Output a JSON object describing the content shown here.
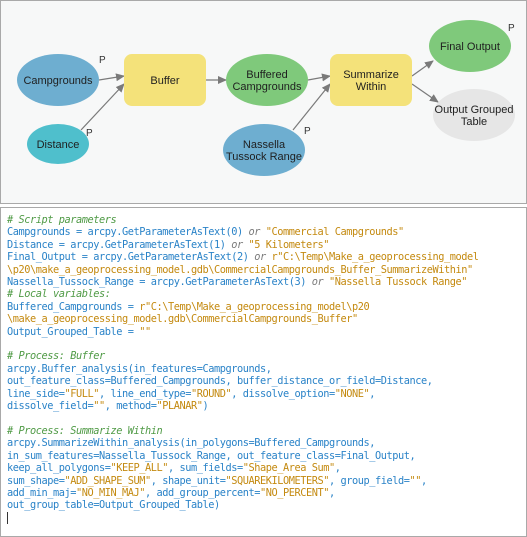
{
  "diagram": {
    "nodes": [
      {
        "id": "campgrounds",
        "label_lines": [
          "Campgrounds"
        ],
        "type": "input",
        "color": "#6eaed0",
        "parameter": true
      },
      {
        "id": "distance",
        "label_lines": [
          "Distance"
        ],
        "type": "input-value",
        "color": "#4fbfcc",
        "parameter": true
      },
      {
        "id": "buffer",
        "label_lines": [
          "Buffer"
        ],
        "type": "tool",
        "color": "#f4e27a",
        "parameter": false
      },
      {
        "id": "buffered-campgrounds",
        "label_lines": [
          "Buffered",
          "Campgrounds"
        ],
        "type": "intermediate",
        "color": "#7fc97b",
        "parameter": false
      },
      {
        "id": "nassella",
        "label_lines": [
          "Nassella",
          "Tussock Range"
        ],
        "type": "input",
        "color": "#6eaed0",
        "parameter": true
      },
      {
        "id": "summarize-within",
        "label_lines": [
          "Summarize",
          "Within"
        ],
        "type": "tool",
        "color": "#f4e27a",
        "parameter": false
      },
      {
        "id": "final-output",
        "label_lines": [
          "Final Output"
        ],
        "type": "output",
        "color": "#7fc97b",
        "parameter": true
      },
      {
        "id": "output-grouped-table",
        "label_lines": [
          "Output Grouped",
          "Table"
        ],
        "type": "output-disabled",
        "color": "#e6e6e6",
        "parameter": false
      }
    ],
    "parameter_marker": "P",
    "edges": [
      [
        "campgrounds",
        "buffer"
      ],
      [
        "distance",
        "buffer"
      ],
      [
        "buffer",
        "buffered-campgrounds"
      ],
      [
        "buffered-campgrounds",
        "summarize-within"
      ],
      [
        "nassella",
        "summarize-within"
      ],
      [
        "summarize-within",
        "final-output"
      ],
      [
        "summarize-within",
        "output-grouped-table"
      ]
    ]
  },
  "code": {
    "lines": [
      [
        {
          "t": "# Script parameters",
          "k": "comment"
        }
      ],
      [
        {
          "t": "Campgrounds = arcpy.GetParameterAsText(0) ",
          "k": "id"
        },
        {
          "t": "or",
          "k": "kw"
        },
        {
          "t": " \"Commercial Campgrounds\"",
          "k": "str"
        }
      ],
      [
        {
          "t": "Distance = arcpy.GetParameterAsText(1) ",
          "k": "id"
        },
        {
          "t": "or",
          "k": "kw"
        },
        {
          "t": " \"5 Kilometers\"",
          "k": "str"
        }
      ],
      [
        {
          "t": "Final_Output = arcpy.GetParameterAsText(2) ",
          "k": "id"
        },
        {
          "t": "or",
          "k": "kw"
        },
        {
          "t": " r\"C:\\Temp\\Make_a_geoprocessing_model",
          "k": "str"
        }
      ],
      [
        {
          "t": "\\p20\\make_a_geoprocessing_model.gdb\\CommercialCampgrounds_Buffer_SummarizeWithin\"",
          "k": "str"
        }
      ],
      [
        {
          "t": "Nassella_Tussock_Range = arcpy.GetParameterAsText(3) ",
          "k": "id"
        },
        {
          "t": "or",
          "k": "kw"
        },
        {
          "t": " \"Nassella Tussock Range\"",
          "k": "str"
        }
      ],
      [
        {
          "t": "# Local variables:",
          "k": "comment"
        }
      ],
      [
        {
          "t": "Buffered_Campgrounds = ",
          "k": "id"
        },
        {
          "t": "r\"C:\\Temp\\Make_a_geoprocessing_model\\p20",
          "k": "str"
        }
      ],
      [
        {
          "t": "\\make_a_geoprocessing_model.gdb\\CommercialCampgrounds_Buffer\"",
          "k": "str"
        }
      ],
      [
        {
          "t": "Output_Grouped_Table = ",
          "k": "id"
        },
        {
          "t": "\"\"",
          "k": "str"
        }
      ],
      [
        {
          "t": "",
          "k": "id"
        }
      ],
      [
        {
          "t": "# Process: Buffer",
          "k": "comment"
        }
      ],
      [
        {
          "t": "arcpy.Buffer_analysis(in_features=Campgrounds,",
          "k": "id"
        }
      ],
      [
        {
          "t": "out_feature_class=Buffered_Campgrounds, buffer_distance_or_field=Distance,",
          "k": "id"
        }
      ],
      [
        {
          "t": "line_side=",
          "k": "id"
        },
        {
          "t": "\"FULL\"",
          "k": "str"
        },
        {
          "t": ", line_end_type=",
          "k": "id"
        },
        {
          "t": "\"ROUND\"",
          "k": "str"
        },
        {
          "t": ", dissolve_option=",
          "k": "id"
        },
        {
          "t": "\"NONE\"",
          "k": "str"
        },
        {
          "t": ",",
          "k": "id"
        }
      ],
      [
        {
          "t": "dissolve_field=",
          "k": "id"
        },
        {
          "t": "\"\"",
          "k": "str"
        },
        {
          "t": ", method=",
          "k": "id"
        },
        {
          "t": "\"PLANAR\"",
          "k": "str"
        },
        {
          "t": ")",
          "k": "id"
        }
      ],
      [
        {
          "t": "",
          "k": "id"
        }
      ],
      [
        {
          "t": "# Process: Summarize Within",
          "k": "comment"
        }
      ],
      [
        {
          "t": "arcpy.SummarizeWithin_analysis(in_polygons=Buffered_Campgrounds,",
          "k": "id"
        }
      ],
      [
        {
          "t": "in_sum_features=Nassella_Tussock_Range, out_feature_class=Final_Output,",
          "k": "id"
        }
      ],
      [
        {
          "t": "keep_all_polygons=",
          "k": "id"
        },
        {
          "t": "\"KEEP_ALL\"",
          "k": "str"
        },
        {
          "t": ", sum_fields=",
          "k": "id"
        },
        {
          "t": "\"Shape_Area Sum\"",
          "k": "str"
        },
        {
          "t": ",",
          "k": "id"
        }
      ],
      [
        {
          "t": "sum_shape=",
          "k": "id"
        },
        {
          "t": "\"ADD_SHAPE_SUM\"",
          "k": "str"
        },
        {
          "t": ", shape_unit=",
          "k": "id"
        },
        {
          "t": "\"SQUAREKILOMETERS\"",
          "k": "str"
        },
        {
          "t": ", group_field=",
          "k": "id"
        },
        {
          "t": "\"\"",
          "k": "str"
        },
        {
          "t": ",",
          "k": "id"
        }
      ],
      [
        {
          "t": "add_min_maj=",
          "k": "id"
        },
        {
          "t": "\"NO_MIN_MAJ\"",
          "k": "str"
        },
        {
          "t": ", add_group_percent=",
          "k": "id"
        },
        {
          "t": "\"NO_PERCENT\"",
          "k": "str"
        },
        {
          "t": ",",
          "k": "id"
        }
      ],
      [
        {
          "t": "out_group_table=Output_Grouped_Table)",
          "k": "id"
        }
      ]
    ]
  }
}
